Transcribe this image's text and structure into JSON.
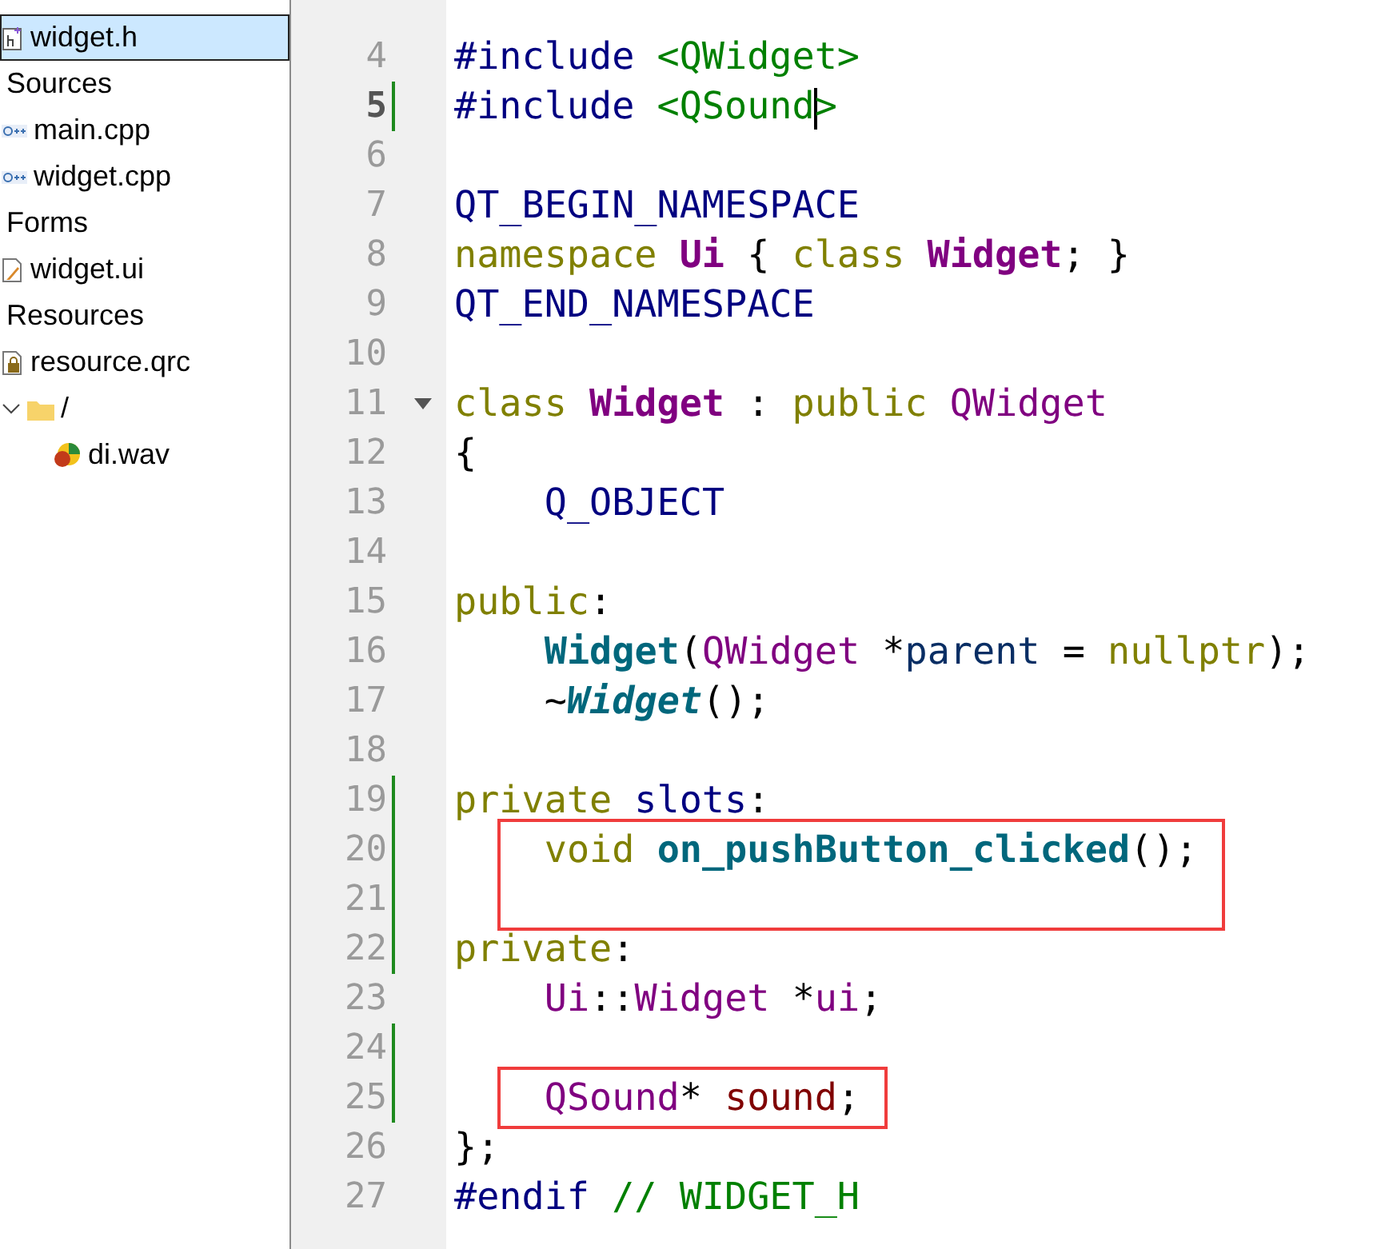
{
  "project_tree": {
    "items": [
      {
        "label": "widget.h",
        "kind": "header",
        "selected": true
      },
      {
        "label": "Sources",
        "kind": "group",
        "selected": false,
        "children": [
          {
            "label": "main.cpp",
            "kind": "source",
            "selected": false
          },
          {
            "label": "widget.cpp",
            "kind": "source",
            "selected": false
          }
        ]
      },
      {
        "label": "Forms",
        "kind": "group",
        "selected": false,
        "children": [
          {
            "label": "widget.ui",
            "kind": "form",
            "selected": false
          }
        ]
      },
      {
        "label": "Resources",
        "kind": "group",
        "selected": false,
        "children": [
          {
            "label": "resource.qrc",
            "kind": "resource",
            "selected": false,
            "children": [
              {
                "label": "/",
                "kind": "folder",
                "selected": false,
                "expanded": true,
                "children": [
                  {
                    "label": "di.wav",
                    "kind": "sound",
                    "selected": false
                  }
                ]
              }
            ]
          }
        ]
      }
    ]
  },
  "editor": {
    "lines": [
      {
        "number": "4",
        "tokens": [
          {
            "text": "#include ",
            "kind": "preproc"
          },
          {
            "text": "<QWidget>",
            "kind": "string"
          }
        ]
      },
      {
        "number": "5",
        "current": true,
        "modified": true,
        "tokens": [
          {
            "text": "#include ",
            "kind": "preproc"
          },
          {
            "text": "<QSound",
            "kind": "string"
          },
          {
            "text": ">",
            "kind": "string",
            "caret_before": true
          }
        ]
      },
      {
        "number": "6"
      },
      {
        "number": "7",
        "tokens": [
          {
            "text": "QT_BEGIN_NAMESPACE",
            "kind": "macro"
          }
        ]
      },
      {
        "number": "8",
        "tokens": [
          {
            "text": "namespace ",
            "kind": "keyword"
          },
          {
            "text": "Ui",
            "kind": "class"
          },
          {
            "text": " { ",
            "kind": "plain"
          },
          {
            "text": "class ",
            "kind": "keyword"
          },
          {
            "text": "Widget",
            "kind": "class"
          },
          {
            "text": "; }",
            "kind": "plain"
          }
        ]
      },
      {
        "number": "9",
        "tokens": [
          {
            "text": "QT_END_NAMESPACE",
            "kind": "macro"
          }
        ]
      },
      {
        "number": "10"
      },
      {
        "number": "11",
        "foldable": true,
        "tokens": [
          {
            "text": "class ",
            "kind": "keyword"
          },
          {
            "text": "Widget",
            "kind": "class"
          },
          {
            "text": " : ",
            "kind": "plain"
          },
          {
            "text": "public ",
            "kind": "keyword"
          },
          {
            "text": "QWidget",
            "kind": "type"
          }
        ]
      },
      {
        "number": "12",
        "tokens": [
          {
            "text": "{",
            "kind": "plain"
          }
        ]
      },
      {
        "number": "13",
        "indent": true,
        "tokens": [
          {
            "text": "Q_OBJECT",
            "kind": "macro"
          }
        ]
      },
      {
        "number": "14"
      },
      {
        "number": "15",
        "tokens": [
          {
            "text": "public",
            "kind": "keyword"
          },
          {
            "text": ":",
            "kind": "plain"
          }
        ]
      },
      {
        "number": "16",
        "indent": true,
        "tokens": [
          {
            "text": "Widget",
            "kind": "function"
          },
          {
            "text": "(",
            "kind": "plain"
          },
          {
            "text": "QWidget",
            "kind": "type"
          },
          {
            "text": " *",
            "kind": "plain"
          },
          {
            "text": "parent",
            "kind": "param"
          },
          {
            "text": " = ",
            "kind": "plain"
          },
          {
            "text": "nullptr",
            "kind": "keyword"
          },
          {
            "text": ");",
            "kind": "plain"
          }
        ]
      },
      {
        "number": "17",
        "indent": true,
        "tokens": [
          {
            "text": "~",
            "kind": "plain"
          },
          {
            "text": "Widget",
            "kind": "virtual"
          },
          {
            "text": "();",
            "kind": "plain"
          }
        ]
      },
      {
        "number": "18"
      },
      {
        "number": "19",
        "modified": true,
        "tokens": [
          {
            "text": "private ",
            "kind": "keyword"
          },
          {
            "text": "slots",
            "kind": "macro"
          },
          {
            "text": ":",
            "kind": "plain"
          }
        ]
      },
      {
        "number": "20",
        "modified": true,
        "boxed": true,
        "indent": true,
        "tokens": [
          {
            "text": "void ",
            "kind": "keyword"
          },
          {
            "text": "on_pushButton_clicked",
            "kind": "function"
          },
          {
            "text": "();",
            "kind": "plain"
          }
        ]
      },
      {
        "number": "21",
        "modified": true,
        "boxed": true
      },
      {
        "number": "22",
        "modified": true,
        "tokens": [
          {
            "text": "private",
            "kind": "keyword"
          },
          {
            "text": ":",
            "kind": "plain"
          }
        ]
      },
      {
        "number": "23",
        "indent": true,
        "tokens": [
          {
            "text": "Ui",
            "kind": "type"
          },
          {
            "text": "::",
            "kind": "plain"
          },
          {
            "text": "Widget",
            "kind": "type"
          },
          {
            "text": " *",
            "kind": "plain"
          },
          {
            "text": "ui",
            "kind": "field"
          },
          {
            "text": ";",
            "kind": "plain"
          }
        ]
      },
      {
        "number": "24",
        "modified": true
      },
      {
        "number": "25",
        "modified": true,
        "boxed": true,
        "indent": true,
        "tokens": [
          {
            "text": "QSound",
            "kind": "type"
          },
          {
            "text": "* ",
            "kind": "plain"
          },
          {
            "text": "sound",
            "kind": "var"
          },
          {
            "text": ";",
            "kind": "plain"
          }
        ]
      },
      {
        "number": "26",
        "tokens": [
          {
            "text": "};",
            "kind": "plain"
          }
        ]
      },
      {
        "number": "27",
        "tokens": [
          {
            "text": "#endif ",
            "kind": "preproc"
          },
          {
            "text": "// WIDGET_H",
            "kind": "comment"
          }
        ]
      }
    ]
  }
}
